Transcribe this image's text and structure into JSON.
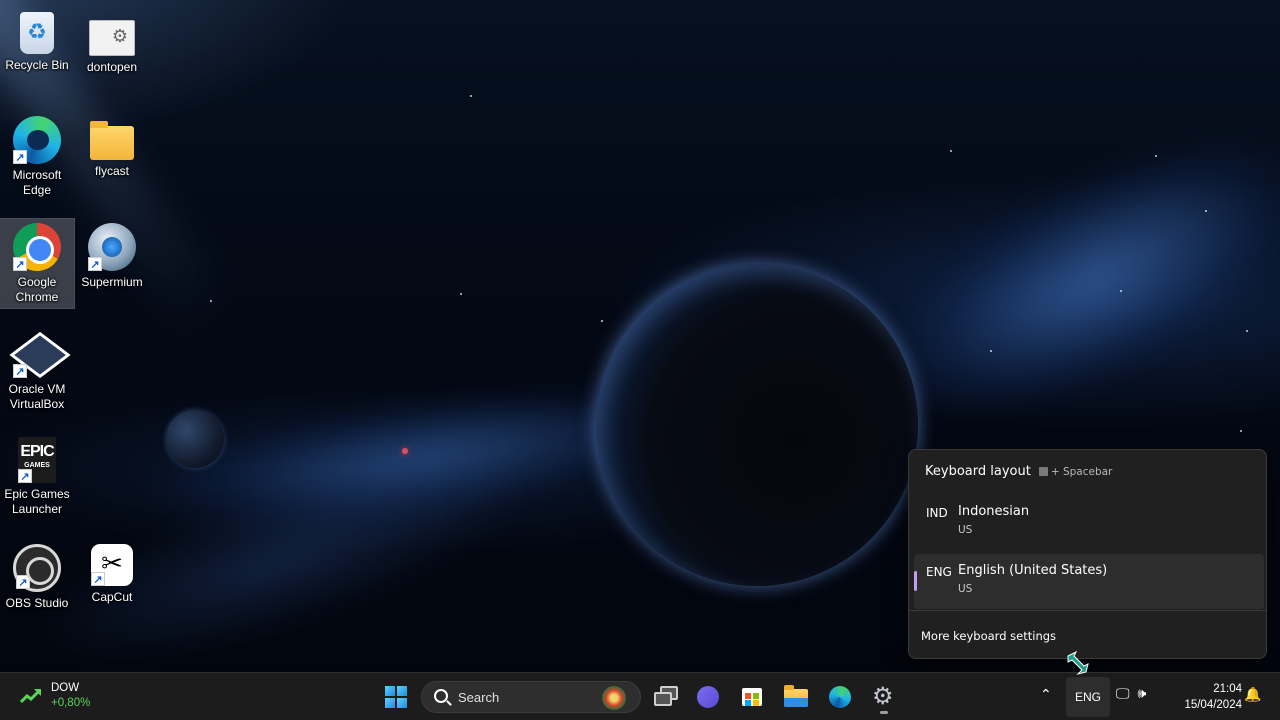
{
  "desktop": {
    "icons": [
      {
        "label": "Recycle Bin"
      },
      {
        "label": "dontopen"
      },
      {
        "label": "Microsoft Edge"
      },
      {
        "label": "flycast"
      },
      {
        "label": "Google Chrome"
      },
      {
        "label": "Supermium"
      },
      {
        "label": "Oracle VM VirtualBox"
      },
      {
        "label": "Epic Games Launcher"
      },
      {
        "label": "OBS Studio"
      },
      {
        "label": "CapCut"
      }
    ],
    "epic_logo_text": [
      "EPIC",
      "GAMES"
    ]
  },
  "keyboard_flyout": {
    "title": "Keyboard layout",
    "shortcut_hint": "+ Spacebar",
    "languages": [
      {
        "code": "IND",
        "name": "Indonesian",
        "layout": "US",
        "active": false
      },
      {
        "code": "ENG",
        "name": "English (United States)",
        "layout": "US",
        "active": true
      }
    ],
    "more_settings": "More keyboard settings",
    "accent_color": "#c59cf0"
  },
  "taskbar": {
    "widget": {
      "title": "DOW",
      "value": "+0,80%",
      "value_color": "#5cd35c"
    },
    "search_placeholder": "Search",
    "tray": {
      "language": "ENG",
      "time": "21:04",
      "date": "15/04/2024"
    }
  }
}
